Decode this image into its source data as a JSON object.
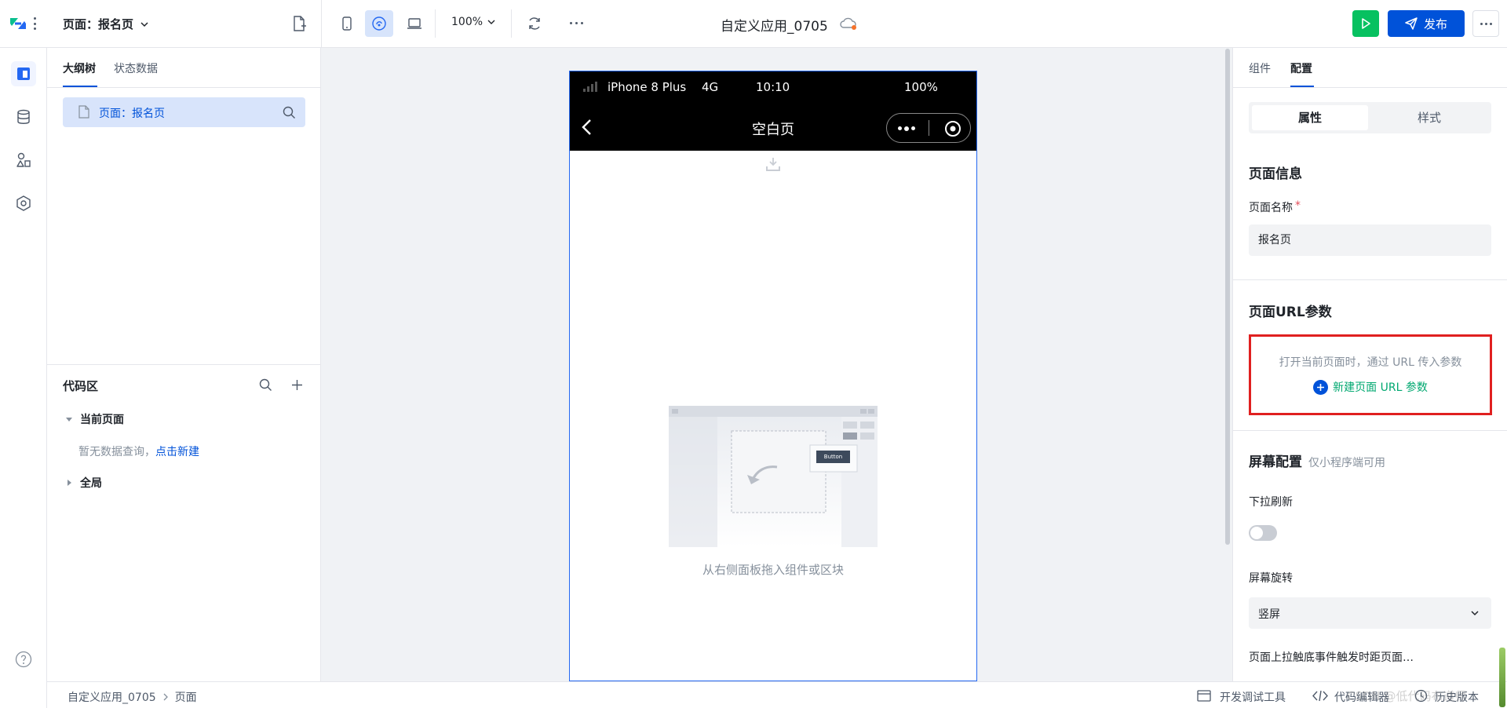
{
  "topbar": {
    "page_selector": "页面：报名页",
    "zoom": "100%",
    "app_title": "自定义应用_0705",
    "publish_label": "发布"
  },
  "left_panel": {
    "tabs": [
      "大纲树",
      "状态数据"
    ],
    "tree_item": "页面：报名页",
    "code_section_title": "代码区",
    "current_page_label": "当前页面",
    "empty_query_text": "暂无数据查询，",
    "create_link": "点击新建",
    "global_label": "全局"
  },
  "phone": {
    "carrier": "iPhone 8 Plus",
    "network": "4G",
    "time": "10:10",
    "battery": "100%",
    "nav_title": "空白页",
    "illustration_button": "Button",
    "empty_hint": "从右侧面板拖入组件或区块"
  },
  "right_panel": {
    "tabs": [
      "组件",
      "配置"
    ],
    "segments": [
      "属性",
      "样式"
    ],
    "page_info_title": "页面信息",
    "page_name_label": "页面名称",
    "required_mark": "*",
    "page_name_value": "报名页",
    "url_params_title": "页面URL参数",
    "url_params_desc": "打开当前页面时，通过 URL 传入参数",
    "new_url_param": "新建页面 URL 参数",
    "screen_config_title": "屏幕配置",
    "screen_config_note": "仅小程序端可用",
    "pull_refresh_label": "下拉刷新",
    "pull_refresh_on": false,
    "rotation_label": "屏幕旋转",
    "rotation_value": "竖屏",
    "reach_bottom_label": "页面上拉触底事件触发时距页面…"
  },
  "bottombar": {
    "breadcrumb": [
      "自定义应用_0705",
      "页面"
    ],
    "dev_tools": "开发调试工具",
    "code_editor": "代码编辑器",
    "history": "历史版本",
    "watermark": "CSDN @低代码布道师"
  },
  "colors": {
    "accent": "#0052d9",
    "run_green": "#07c160",
    "link_green": "#00a870",
    "highlight_red": "#e02020"
  }
}
